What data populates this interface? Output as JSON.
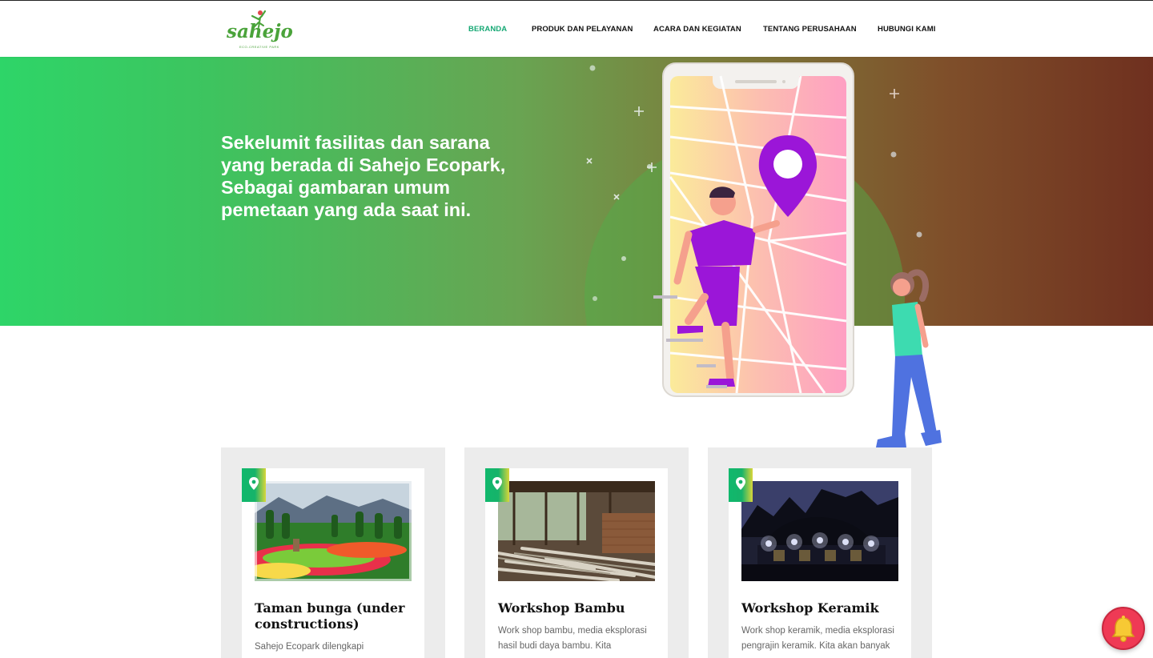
{
  "header": {
    "logo_text": "sahejo",
    "logo_subtitle": "ECO-CREATIVE PARK",
    "nav": [
      {
        "label": "BERANDA",
        "active": true
      },
      {
        "label": "PRODUK DAN PELAYANAN",
        "active": false
      },
      {
        "label": "ACARA DAN KEGIATAN",
        "active": false
      },
      {
        "label": "TENTANG PERUSAHAAN",
        "active": false
      },
      {
        "label": "HUBUNGI KAMI",
        "active": false
      }
    ]
  },
  "hero": {
    "title": "Sekelumit fasilitas dan sarana yang berada di Sahejo Ecopark, Sebagai gambaran umum pemetaan yang ada saat ini."
  },
  "cards": [
    {
      "title": "Taman bunga (under constructions)",
      "description": "Sahejo Ecopark dilengkapi",
      "badge_icon": "map-pin-icon"
    },
    {
      "title": "Workshop Bambu",
      "description": "Work shop bambu, media eksplorasi hasil budi daya bambu. Kita",
      "badge_icon": "map-pin-icon"
    },
    {
      "title": "Workshop Keramik",
      "description": "Work shop keramik, media eksplorasi pengrajin keramik. Kita akan banyak",
      "badge_icon": "map-pin-icon"
    }
  ],
  "notification": {
    "icon": "bell-icon"
  },
  "colors": {
    "accent": "#16a874",
    "hero_start": "#2ed568",
    "hero_end": "#6f301f",
    "bell": "#ef3a55"
  }
}
